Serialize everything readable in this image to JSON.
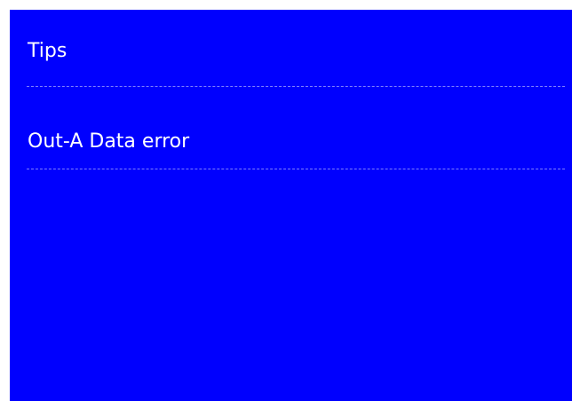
{
  "screen": {
    "title": "Tips",
    "message": "Out-A Data error",
    "colors": {
      "background": "#0000fe",
      "text": "#ffffff",
      "divider": "#8c8cff"
    }
  }
}
